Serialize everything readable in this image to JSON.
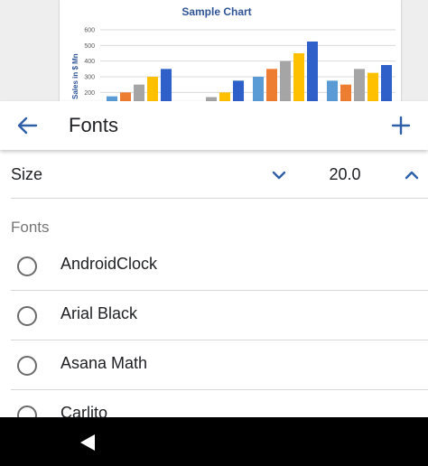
{
  "preview": {
    "chart_data": {
      "type": "bar",
      "title": "Sample Chart",
      "ylabel": "Sales in $ Mn",
      "yticks": [
        "600",
        "500",
        "400",
        "300",
        "200"
      ],
      "ylim": [
        150,
        600
      ],
      "groups": [
        {
          "values": [
            175,
            200,
            250,
            300,
            350
          ],
          "colors": [
            "#5b9bd5",
            "#ed7d31",
            "#a5a5a5",
            "#ffc000",
            "#2f5fc8"
          ]
        },
        {
          "values": [
            170,
            200,
            275
          ],
          "colors": [
            "#a5a5a5",
            "#ffc000",
            "#2f5fc8"
          ]
        },
        {
          "values": [
            300,
            350,
            400,
            450,
            525
          ],
          "colors": [
            "#5b9bd5",
            "#ed7d31",
            "#a5a5a5",
            "#ffc000",
            "#2f5fc8"
          ]
        },
        {
          "values": [
            275,
            250,
            350,
            325,
            375
          ],
          "colors": [
            "#5b9bd5",
            "#ed7d31",
            "#a5a5a5",
            "#ffc000",
            "#2f5fc8"
          ]
        }
      ],
      "colors": {
        "title": "#2f5597",
        "grid": "#d9d9d9",
        "tick": "#595959"
      }
    }
  },
  "toolbar": {
    "title": "Fonts",
    "back_icon": "arrow-left-icon",
    "add_icon": "plus-icon"
  },
  "size": {
    "label": "Size",
    "value": "20.0"
  },
  "fonts_section": {
    "title": "Fonts",
    "items": [
      {
        "name": "AndroidClock"
      },
      {
        "name": "Arial Black"
      },
      {
        "name": "Asana Math"
      },
      {
        "name": "Carlito"
      }
    ]
  },
  "colors": {
    "accent": "#2f5fa7",
    "divider": "#d6d6d6"
  }
}
